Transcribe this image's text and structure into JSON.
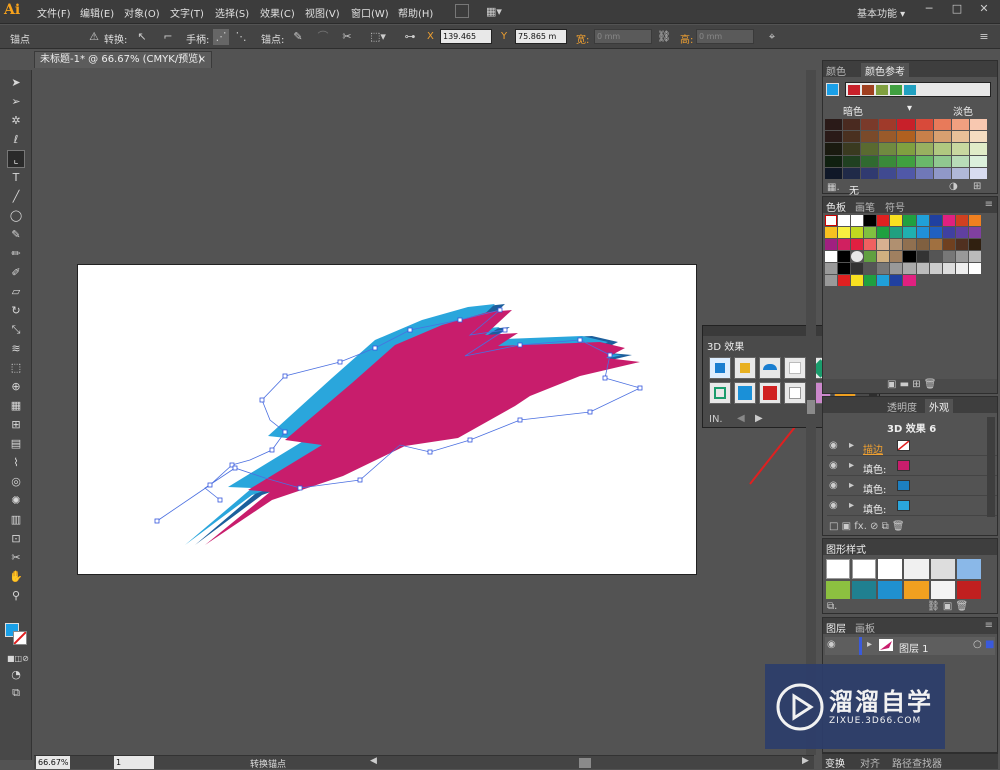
{
  "app": {
    "logo": "Ai"
  },
  "menu": [
    "文件(F)",
    "编辑(E)",
    "对象(O)",
    "文字(T)",
    "选择(S)",
    "效果(C)",
    "视图(V)",
    "窗口(W)",
    "帮助(H)"
  ],
  "workspace": "基本功能",
  "window_controls": [
    "─",
    "□",
    "✕"
  ],
  "control_bar": {
    "tool_name": "锚点",
    "convert_label": "转换:",
    "handle_label": "手柄:",
    "anchor_label": "锚点:",
    "x_label": "X",
    "x_value": "139.465",
    "y_label": "Y",
    "y_value": "75.865 m",
    "w_label": "宽:",
    "w_value": "0 mm",
    "h_label": "高:",
    "h_value": "0 mm"
  },
  "document_tab": {
    "title": "未标题-1* @ 66.67% (CMYK/预览)",
    "close": "×"
  },
  "status_bar": {
    "zoom": "66.67%",
    "page": "1",
    "tool_status": "转换锚点"
  },
  "color_panel": {
    "tabs": [
      "颜色",
      "颜色参考"
    ],
    "left_label": "暗色",
    "right_label": "淡色",
    "footer_none": "无"
  },
  "swatch_panel": {
    "tabs": [
      "色板",
      "画笔",
      "符号"
    ]
  },
  "appearance_panel": {
    "tabs": [
      "透明度",
      "外观"
    ],
    "title": "3D 效果 6",
    "rows": [
      {
        "label": "描边",
        "color": "#d63a6a"
      },
      {
        "label": "填色:",
        "color": "#c81d6c"
      },
      {
        "label": "填色:",
        "color": "#1c7fc0"
      },
      {
        "label": "填色:",
        "color": "#2aa6dc"
      }
    ]
  },
  "graphic_styles_panel": {
    "tabs": [
      "图形样式"
    ]
  },
  "layers_panel": {
    "tabs": [
      "图层",
      "画板"
    ],
    "layer_name": "图层 1"
  },
  "bottom_tabs": [
    "变换",
    "对齐",
    "路径查找器"
  ],
  "fx3d_panel": {
    "title": "3D 效果",
    "footer": "IN."
  },
  "watermark": {
    "title": "溜溜自学",
    "url": "ZIXUE.3D66.COM"
  },
  "colors": {
    "accent_fill": "#c81d6c",
    "side_blue": "#1c7fc0",
    "side_teal": "#2aa6dc",
    "highlight_circle": "#e02020"
  }
}
